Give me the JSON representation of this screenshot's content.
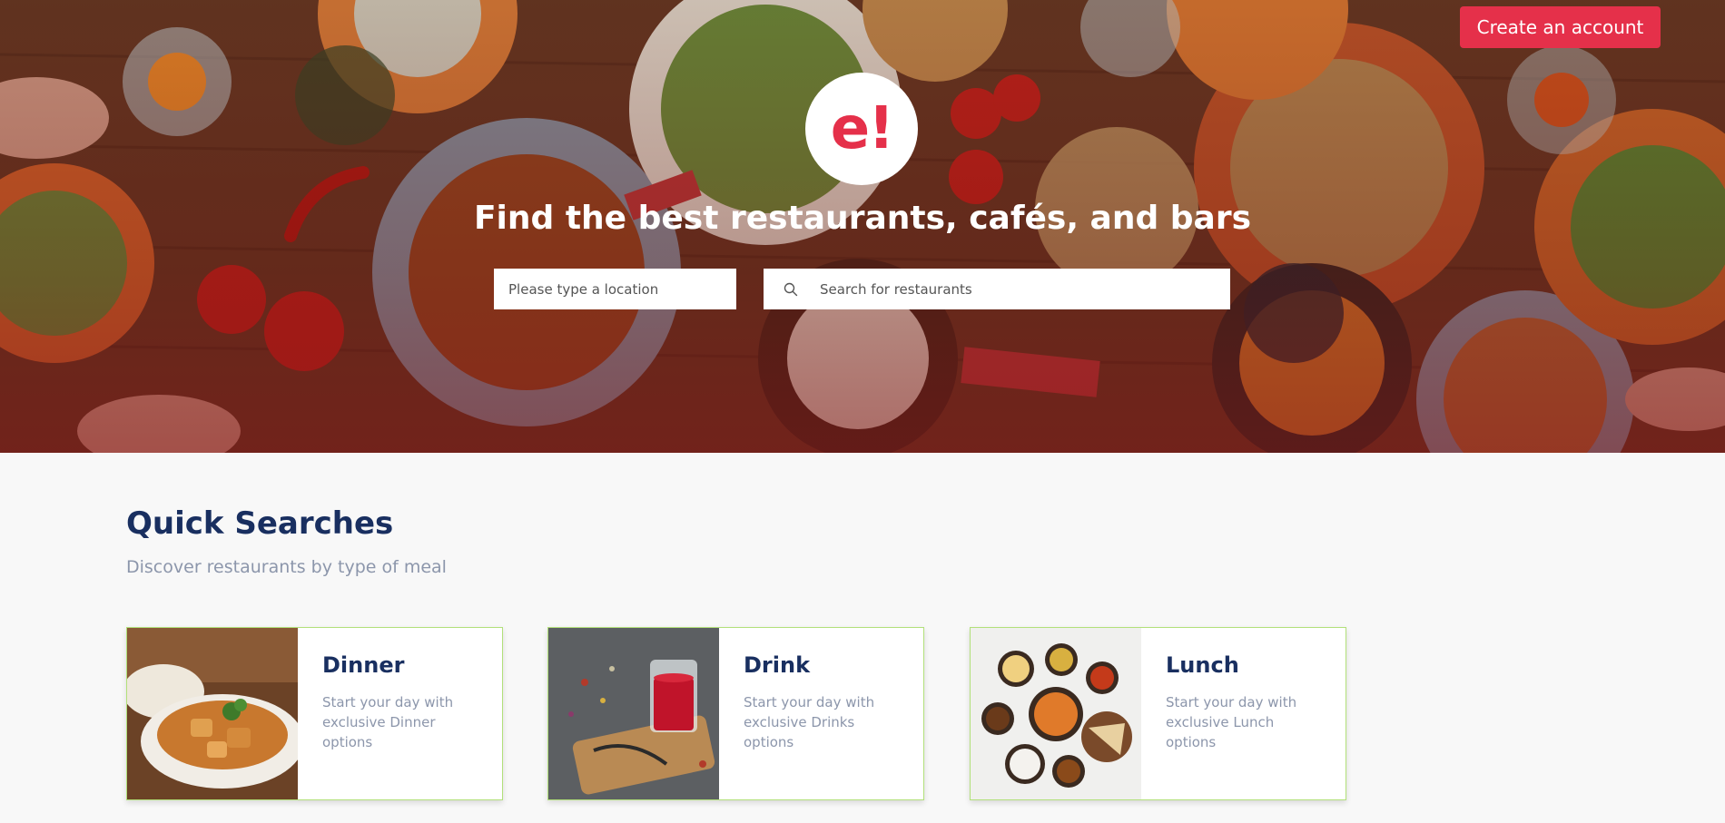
{
  "header": {
    "create_account_label": "Create an account"
  },
  "hero": {
    "logo_text": "e!",
    "headline": "Find the best restaurants, cafés, and bars",
    "location_placeholder": "Please type a location",
    "search_placeholder": "Search for restaurants"
  },
  "quick_searches": {
    "title": "Quick Searches",
    "subtitle": "Discover restaurants by type of meal",
    "cards": [
      {
        "title": "Dinner",
        "description": "Start your day with exclusive Dinner options",
        "image": "curry-bowl-image"
      },
      {
        "title": "Drink",
        "description": "Start your day with exclusive Drinks options",
        "image": "tea-glass-image"
      },
      {
        "title": "Lunch",
        "description": "Start your day with exclusive Lunch options",
        "image": "thali-platter-image"
      }
    ]
  },
  "colors": {
    "brand_red": "#e5304a",
    "heading_navy": "#192f60",
    "muted_text": "#8c96ab",
    "card_border": "#b2e07a"
  },
  "icons": {
    "search": "search-icon"
  }
}
